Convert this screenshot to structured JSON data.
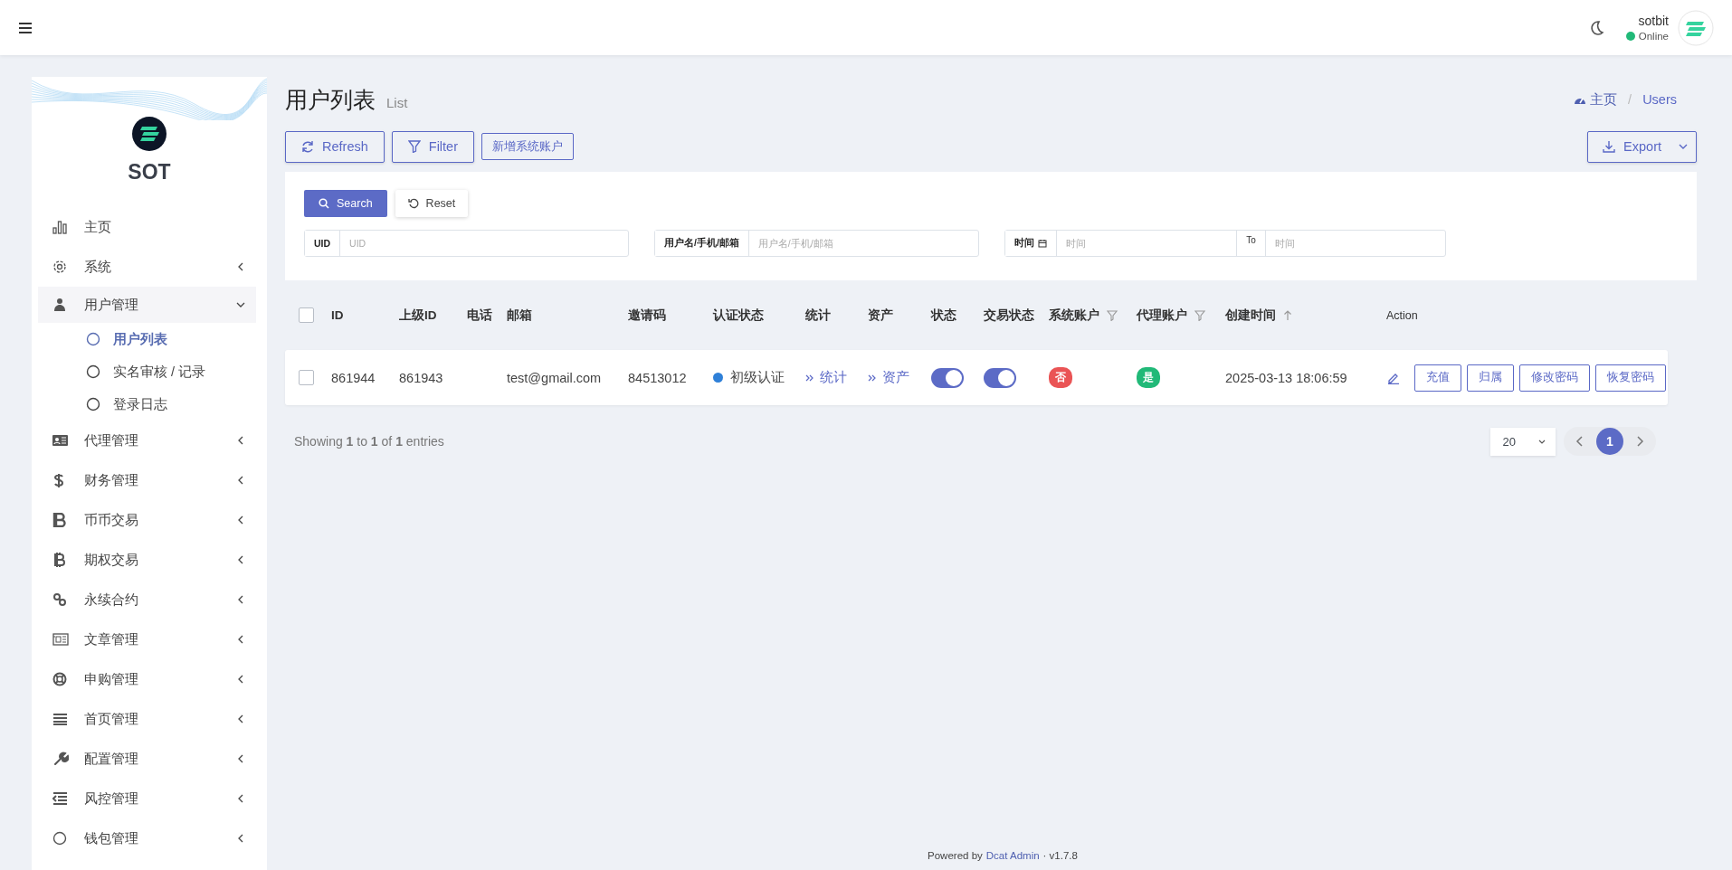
{
  "header": {
    "user": {
      "name": "sotbit",
      "status": "Online",
      "online": true
    }
  },
  "sidebar": {
    "brand": "SOT",
    "items": [
      {
        "label": "主页",
        "kind": "link"
      },
      {
        "label": "系统",
        "kind": "group",
        "expanded": false
      },
      {
        "label": "用户管理",
        "kind": "group",
        "expanded": true,
        "children": [
          {
            "label": "用户列表",
            "selected": true
          },
          {
            "label": "实名审核 / 记录",
            "selected": false
          },
          {
            "label": "登录日志",
            "selected": false
          }
        ]
      },
      {
        "label": "代理管理",
        "kind": "group",
        "expanded": false
      },
      {
        "label": "财务管理",
        "kind": "group",
        "expanded": false
      },
      {
        "label": "币币交易",
        "kind": "group",
        "expanded": false
      },
      {
        "label": "期权交易",
        "kind": "group",
        "expanded": false
      },
      {
        "label": "永续合约",
        "kind": "group",
        "expanded": false
      },
      {
        "label": "文章管理",
        "kind": "group",
        "expanded": false
      },
      {
        "label": "申购管理",
        "kind": "group",
        "expanded": false
      },
      {
        "label": "首页管理",
        "kind": "group",
        "expanded": false
      },
      {
        "label": "配置管理",
        "kind": "group",
        "expanded": false
      },
      {
        "label": "风控管理",
        "kind": "group",
        "expanded": false
      },
      {
        "label": "钱包管理",
        "kind": "group",
        "expanded": false
      }
    ]
  },
  "page": {
    "title": "用户列表",
    "subtitle": "List",
    "breadcrumb": [
      {
        "label": "主页",
        "kind": "home"
      },
      {
        "label": "/",
        "kind": "separator"
      },
      {
        "label": "Users",
        "kind": "current"
      }
    ]
  },
  "toolbar": {
    "buttons": [
      {
        "label": "Refresh",
        "kind": "refresh"
      },
      {
        "label": "Filter",
        "kind": "filter"
      },
      {
        "label": "新增系统账户",
        "kind": "plain"
      }
    ],
    "export": "Export"
  },
  "filter": {
    "search": "Search",
    "reset": "Reset",
    "fields": [
      {
        "label": "UID",
        "placeholder": "UID",
        "kind": "text"
      },
      {
        "label": "用户名/手机/邮箱",
        "placeholder": "用户名/手机/邮箱",
        "kind": "text"
      },
      {
        "label": "时间",
        "placeholder": "时间",
        "kind": "range",
        "to": "To",
        "placeholder_to": "时间"
      }
    ]
  },
  "table": {
    "all_checked": false,
    "columns": [
      {
        "label": "ID",
        "kind": "plain"
      },
      {
        "label": "上级ID",
        "kind": "plain"
      },
      {
        "label": "电话",
        "kind": "plain"
      },
      {
        "label": "邮箱",
        "kind": "plain"
      },
      {
        "label": "邀请码",
        "kind": "plain"
      },
      {
        "label": "认证状态",
        "kind": "plain"
      },
      {
        "label": "统计",
        "kind": "plain"
      },
      {
        "label": "资产",
        "kind": "plain"
      },
      {
        "label": "状态",
        "kind": "plain"
      },
      {
        "label": "交易状态",
        "kind": "plain"
      },
      {
        "label": "系统账户",
        "kind": "filter"
      },
      {
        "label": "代理账户",
        "kind": "filter"
      },
      {
        "label": "创建时间",
        "kind": "sort"
      },
      {
        "label": "Action",
        "kind": "action"
      }
    ],
    "rows": [
      {
        "checked": false,
        "id": "861944",
        "parent_id": "861943",
        "email": "test@gmail.com",
        "invite_code": "84513012",
        "auth": {
          "text": "初级认证",
          "color": "#2f80d8"
        },
        "stats": "统计",
        "assets": "资产",
        "status_on": true,
        "trade_on": true,
        "system_account": {
          "text": "否",
          "color": "#ea5455"
        },
        "agent_account": {
          "text": "是",
          "color": "#21b978"
        },
        "created": "2025-03-13 18:06:59",
        "actions": [
          "充值",
          "归属",
          "修改密码",
          "恢复密码"
        ]
      }
    ]
  },
  "footer": {
    "summary": "Showing **1** to **1** of **1** entries",
    "per_page": "20",
    "pages": [
      {
        "label": "1",
        "selected": true
      }
    ]
  },
  "powered": {
    "prefix": "Powered by",
    "link": "Dcat Admin",
    "suffix": "· v1.7.8"
  }
}
